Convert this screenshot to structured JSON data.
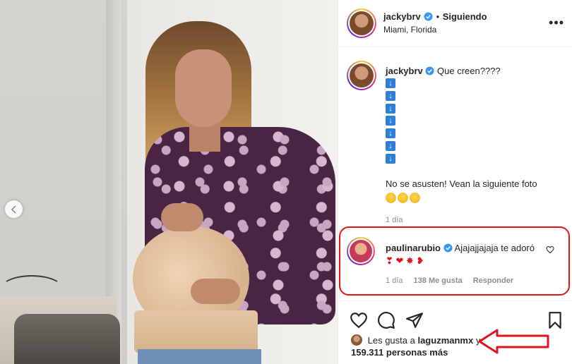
{
  "post": {
    "header": {
      "username": "jackybrv",
      "separator": "•",
      "follow_status": "Siguiendo",
      "location": "Miami, Florida",
      "more_label": "•••"
    },
    "caption": {
      "username": "jackybrv",
      "text": "Que creen????",
      "arrow_glyph": "↓",
      "arrow_count": 7,
      "text2": "No se asusten! Vean la siguiente foto",
      "emojis": [
        "laughing-with-tears",
        "laughing-with-tears",
        "laughing-with-tears"
      ],
      "time": "1 día"
    },
    "comment": {
      "username": "paulinarubio",
      "text": "Ajajajjajaja te adoró",
      "emojis": [
        "red-heart-broken",
        "red-heart",
        "collision",
        "kiss-mark"
      ],
      "time": "1 día",
      "likes": "138 Me gusta",
      "reply_label": "Responder",
      "highlight_color": "#e0141b"
    },
    "likes": {
      "prefix": "Les gusta a",
      "user": "laguzmanmx",
      "connector": "y",
      "count": "159.311 personas más"
    }
  },
  "colors": {
    "accent_red": "#e0141b",
    "verified_blue": "#3897f0",
    "arrow_box_blue": "#2f7fd6"
  }
}
